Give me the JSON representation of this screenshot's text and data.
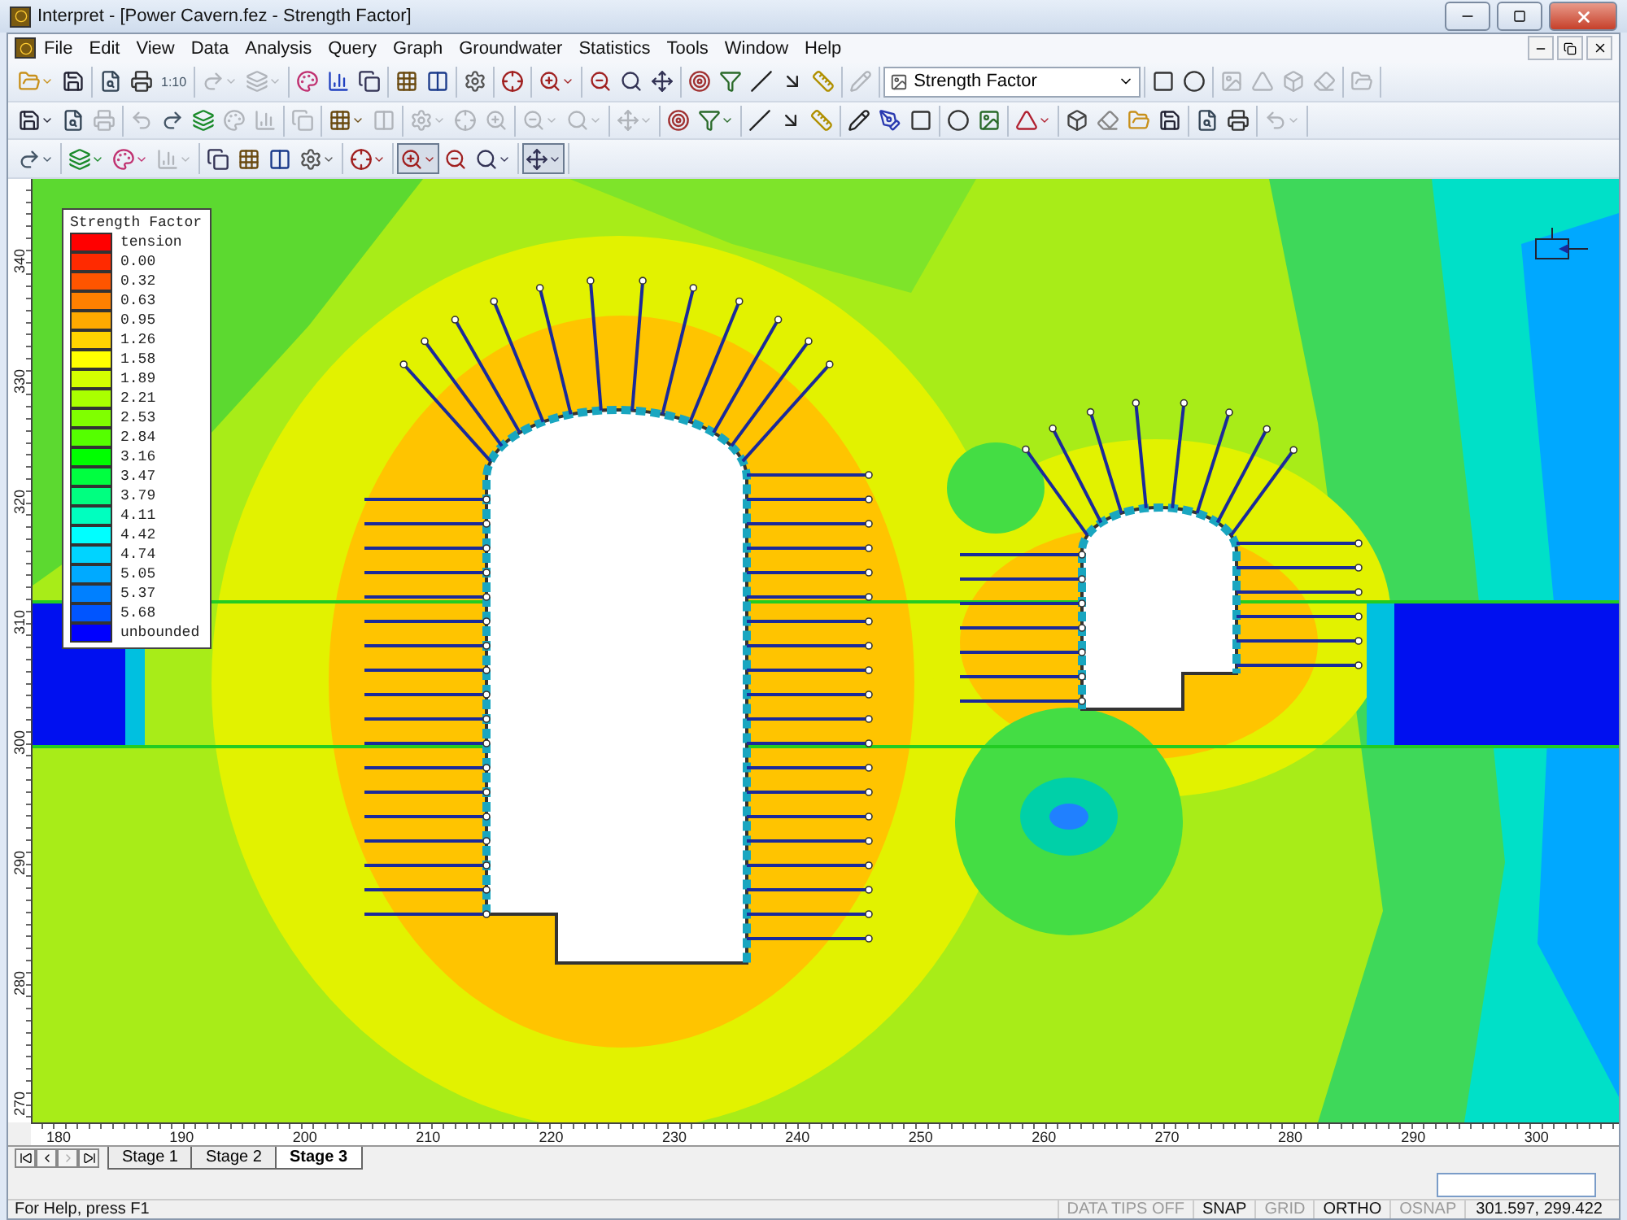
{
  "window": {
    "title": "Interpret - [Power Cavern.fez - Strength Factor]"
  },
  "menu": [
    "File",
    "Edit",
    "View",
    "Data",
    "Analysis",
    "Query",
    "Graph",
    "Groundwater",
    "Statistics",
    "Tools",
    "Window",
    "Help"
  ],
  "toolbars": [
    [
      [
        {
          "kind": "icon",
          "disabled": false,
          "dropdown": true
        },
        {
          "kind": "icon",
          "disabled": false
        }
      ],
      [
        {
          "kind": "icon",
          "disabled": false
        },
        {
          "kind": "icon",
          "disabled": false
        },
        {
          "kind": "text",
          "label": "1:10",
          "disabled": false
        }
      ],
      [
        {
          "kind": "icon",
          "disabled": true,
          "dropdown": true
        },
        {
          "kind": "icon",
          "disabled": true,
          "dropdown": true
        }
      ],
      [
        {
          "kind": "icon",
          "disabled": false
        },
        {
          "kind": "icon",
          "disabled": false
        },
        {
          "kind": "icon",
          "disabled": false
        }
      ],
      [
        {
          "kind": "icon",
          "disabled": false
        },
        {
          "kind": "icon",
          "disabled": false
        }
      ],
      [
        {
          "kind": "icon",
          "disabled": false
        }
      ],
      [
        {
          "kind": "icon",
          "disabled": false
        }
      ],
      [
        {
          "kind": "icon",
          "disabled": false,
          "dropdown": true
        }
      ],
      [
        {
          "kind": "icon",
          "disabled": false
        },
        {
          "kind": "icon",
          "disabled": false
        },
        {
          "kind": "icon",
          "disabled": false
        }
      ],
      [
        {
          "kind": "icon",
          "disabled": false
        },
        {
          "kind": "icon",
          "disabled": false
        },
        {
          "kind": "icon",
          "disabled": false
        },
        {
          "kind": "icon",
          "disabled": false
        },
        {
          "kind": "icon",
          "disabled": false
        }
      ],
      [
        {
          "kind": "icon",
          "disabled": true
        }
      ],
      [
        {
          "kind": "combo",
          "value": "Strength Factor",
          "disabled": false
        }
      ],
      [
        {
          "kind": "icon",
          "disabled": false
        },
        {
          "kind": "icon",
          "disabled": false
        }
      ],
      [
        {
          "kind": "icon",
          "disabled": true
        },
        {
          "kind": "icon",
          "disabled": true
        },
        {
          "kind": "icon",
          "disabled": true
        },
        {
          "kind": "icon",
          "disabled": true
        }
      ],
      [
        {
          "kind": "icon",
          "disabled": true
        }
      ]
    ],
    [
      [
        {
          "kind": "icon",
          "disabled": false,
          "dropdown": true
        },
        {
          "kind": "icon",
          "disabled": false
        },
        {
          "kind": "icon",
          "disabled": true
        }
      ],
      [
        {
          "kind": "icon",
          "disabled": true
        },
        {
          "kind": "icon",
          "disabled": false
        },
        {
          "kind": "icon",
          "disabled": false
        },
        {
          "kind": "icon",
          "disabled": true
        },
        {
          "kind": "icon",
          "disabled": true
        }
      ],
      [
        {
          "kind": "icon",
          "disabled": true
        }
      ],
      [
        {
          "kind": "icon",
          "disabled": false,
          "dropdown": true
        },
        {
          "kind": "icon",
          "disabled": true
        }
      ],
      [
        {
          "kind": "icon",
          "disabled": true,
          "dropdown": true
        },
        {
          "kind": "icon",
          "disabled": true
        },
        {
          "kind": "icon",
          "disabled": true
        }
      ],
      [
        {
          "kind": "icon",
          "disabled": true,
          "dropdown": true
        },
        {
          "kind": "icon",
          "disabled": true,
          "dropdown": true
        }
      ],
      [
        {
          "kind": "icon",
          "disabled": true,
          "dropdown": true
        }
      ],
      [
        {
          "kind": "icon",
          "disabled": false
        },
        {
          "kind": "icon",
          "disabled": false,
          "dropdown": true
        }
      ],
      [
        {
          "kind": "icon",
          "disabled": false
        },
        {
          "kind": "icon",
          "disabled": false
        },
        {
          "kind": "icon",
          "disabled": false
        }
      ],
      [
        {
          "kind": "icon",
          "disabled": false
        },
        {
          "kind": "icon",
          "disabled": false
        },
        {
          "kind": "icon",
          "disabled": false
        }
      ],
      [
        {
          "kind": "icon",
          "disabled": false
        },
        {
          "kind": "icon",
          "disabled": false
        }
      ],
      [
        {
          "kind": "icon",
          "disabled": false,
          "dropdown": true
        }
      ],
      [
        {
          "kind": "icon",
          "disabled": false
        },
        {
          "kind": "icon",
          "disabled": false
        },
        {
          "kind": "icon",
          "disabled": false
        },
        {
          "kind": "icon",
          "disabled": false
        }
      ],
      [
        {
          "kind": "icon",
          "disabled": false
        },
        {
          "kind": "icon",
          "disabled": false
        }
      ],
      [
        {
          "kind": "icon",
          "disabled": true,
          "dropdown": true
        }
      ]
    ],
    [
      [
        {
          "kind": "icon",
          "disabled": false,
          "dropdown": true
        }
      ],
      [
        {
          "kind": "icon",
          "disabled": false,
          "dropdown": true
        },
        {
          "kind": "icon",
          "disabled": false,
          "dropdown": true
        },
        {
          "kind": "icon",
          "disabled": true,
          "dropdown": true
        }
      ],
      [
        {
          "kind": "icon",
          "disabled": false
        },
        {
          "kind": "icon",
          "disabled": false
        },
        {
          "kind": "icon",
          "disabled": false
        },
        {
          "kind": "icon",
          "disabled": false,
          "dropdown": true
        }
      ],
      [
        {
          "kind": "icon",
          "disabled": false,
          "dropdown": true
        }
      ],
      [
        {
          "kind": "icon",
          "disabled": false,
          "dropdown": true,
          "pressed": true
        },
        {
          "kind": "icon",
          "disabled": false
        },
        {
          "kind": "icon",
          "disabled": false,
          "dropdown": true
        }
      ],
      [
        {
          "kind": "icon",
          "disabled": false,
          "dropdown": true,
          "pressed": true
        }
      ]
    ]
  ],
  "legend": {
    "title": "Strength Factor",
    "items": [
      {
        "label": "tension",
        "color": "#ff0000"
      },
      {
        "label": "0.00",
        "color": "#ff2a00"
      },
      {
        "label": "0.32",
        "color": "#ff5500"
      },
      {
        "label": "0.63",
        "color": "#ff8000"
      },
      {
        "label": "0.95",
        "color": "#ffaa00"
      },
      {
        "label": "1.26",
        "color": "#ffd400"
      },
      {
        "label": "1.58",
        "color": "#ffff00"
      },
      {
        "label": "1.89",
        "color": "#d4ff00"
      },
      {
        "label": "2.21",
        "color": "#aaff00"
      },
      {
        "label": "2.53",
        "color": "#80ff00"
      },
      {
        "label": "2.84",
        "color": "#55ff00"
      },
      {
        "label": "3.16",
        "color": "#00ff00"
      },
      {
        "label": "3.47",
        "color": "#00ff40"
      },
      {
        "label": "3.79",
        "color": "#00ff80"
      },
      {
        "label": "4.11",
        "color": "#00ffbf"
      },
      {
        "label": "4.42",
        "color": "#00ffff"
      },
      {
        "label": "4.74",
        "color": "#00d4ff"
      },
      {
        "label": "5.05",
        "color": "#00aaff"
      },
      {
        "label": "5.37",
        "color": "#0080ff"
      },
      {
        "label": "5.68",
        "color": "#0055ff"
      },
      {
        "label": "unbounded",
        "color": "#0000ff"
      }
    ]
  },
  "y_axis": {
    "ticks": [
      "340",
      "330",
      "320",
      "310",
      "300",
      "290",
      "280",
      "270"
    ]
  },
  "x_axis": {
    "ticks": [
      "180",
      "190",
      "200",
      "210",
      "220",
      "230",
      "240",
      "250",
      "260",
      "270",
      "280",
      "290",
      "300"
    ]
  },
  "stage_nav": [
    {
      "disabled": false
    },
    {
      "disabled": false
    },
    {
      "disabled": true
    },
    {
      "disabled": false
    }
  ],
  "stages": [
    {
      "label": "Stage 1",
      "selected": false
    },
    {
      "label": "Stage 2",
      "selected": false
    },
    {
      "label": "Stage 3",
      "selected": true
    }
  ],
  "status_bar": {
    "help": "For Help, press F1",
    "indicators": [
      {
        "label": "DATA TIPS OFF",
        "on": false
      },
      {
        "label": "SNAP",
        "on": true
      },
      {
        "label": "GRID",
        "on": false
      },
      {
        "label": "ORTHO",
        "on": true
      },
      {
        "label": "OSNAP",
        "on": false
      }
    ],
    "coordinates": "301.597,  299.422"
  }
}
